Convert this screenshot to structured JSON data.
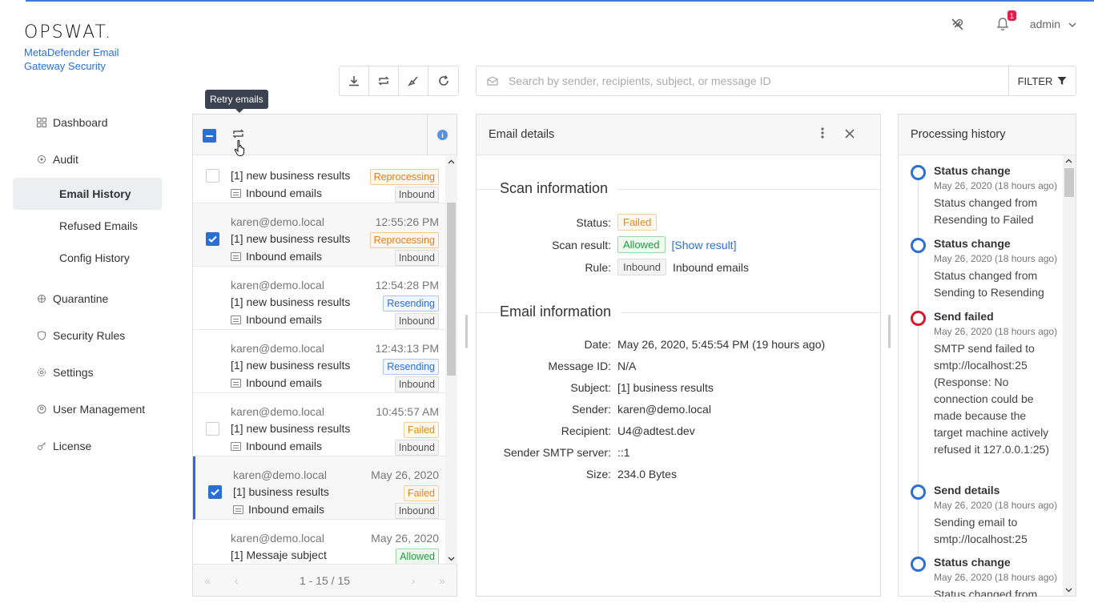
{
  "brand": {
    "logo": "OPSWAT.",
    "product": "MetaDefender Email Gateway Security"
  },
  "header": {
    "notification_count": "1",
    "user": "admin"
  },
  "nav": {
    "dashboard": "Dashboard",
    "audit": "Audit",
    "email_history": "Email History",
    "refused_emails": "Refused Emails",
    "config_history": "Config History",
    "quarantine": "Quarantine",
    "security_rules": "Security Rules",
    "settings": "Settings",
    "user_management": "User Management",
    "license": "License"
  },
  "search": {
    "placeholder": "Search by sender, recipients, subject, or message ID",
    "filter_label": "FILTER"
  },
  "tooltip": "Retry emails",
  "list": {
    "rows": [
      {
        "sender": "",
        "time": "",
        "subject": "[1] new business results",
        "status": "Reprocessing",
        "rule": "Inbound emails",
        "direction": "Inbound",
        "checked": false
      },
      {
        "sender": "karen@demo.local",
        "time": "12:55:26 PM",
        "subject": "[1] new business results",
        "status": "Reprocessing",
        "rule": "Inbound emails",
        "direction": "Inbound",
        "checked": true
      },
      {
        "sender": "karen@demo.local",
        "time": "12:54:28 PM",
        "subject": "[1] new business results",
        "status": "Resending",
        "rule": "Inbound emails",
        "direction": "Inbound",
        "checked": false
      },
      {
        "sender": "karen@demo.local",
        "time": "12:43:13 PM",
        "subject": "[1] new business results",
        "status": "Resending",
        "rule": "Inbound emails",
        "direction": "Inbound",
        "checked": false
      },
      {
        "sender": "karen@demo.local",
        "time": "10:45:57 AM",
        "subject": "[1] new business results",
        "status": "Failed",
        "rule": "Inbound emails",
        "direction": "Inbound",
        "checked": false
      },
      {
        "sender": "karen@demo.local",
        "time": "May 26, 2020",
        "subject": "[1] business results",
        "status": "Failed",
        "rule": "Inbound emails",
        "direction": "Inbound",
        "checked": true
      },
      {
        "sender": "karen@demo.local",
        "time": "May 26, 2020",
        "subject": "[1] Messaje subject",
        "status": "Allowed",
        "rule": "Inbound emails",
        "direction": "Inbound",
        "checked": false
      }
    ],
    "pagination": "1 - 15 / 15"
  },
  "details": {
    "title": "Email details",
    "scan_title": "Scan information",
    "status_label": "Status:",
    "status": "Failed",
    "scan_result_label": "Scan result:",
    "scan_result": "Allowed",
    "show_result": "[Show result]",
    "rule_label": "Rule:",
    "rule_tag": "Inbound",
    "rule_name": "Inbound emails",
    "email_title": "Email information",
    "fields": [
      {
        "label": "Date:",
        "value": "May 26, 2020, 5:45:54 PM (19 hours ago)"
      },
      {
        "label": "Message ID:",
        "value": "N/A"
      },
      {
        "label": "Subject:",
        "value": "[1] business results"
      },
      {
        "label": "Sender:",
        "value": "karen@demo.local"
      },
      {
        "label": "Recipient:",
        "value": "U4@adtest.dev"
      },
      {
        "label": "Sender SMTP server:",
        "value": "::1"
      },
      {
        "label": "Size:",
        "value": "234.0 Bytes"
      }
    ]
  },
  "history": {
    "title": "Processing history",
    "events": [
      {
        "title": "Status change",
        "date": "May 26, 2020 (18 hours ago)",
        "desc": "Status changed from Resending to Failed"
      },
      {
        "title": "Status change",
        "date": "May 26, 2020 (18 hours ago)",
        "desc": "Status changed from Sending to Resending"
      },
      {
        "title": "Send failed",
        "date": "May 26, 2020 (18 hours ago)",
        "desc": "SMTP send failed to smtp://localhost:25 (Response: No connection could be made because the target machine actively refused it 127.0.0.1:25)"
      },
      {
        "title": "Send details",
        "date": "May 26, 2020 (18 hours ago)",
        "desc": "Sending email to smtp://localhost:25"
      },
      {
        "title": "Status change",
        "date": "May 26, 2020 (18 hours ago)",
        "desc": "Status changed from"
      }
    ]
  },
  "colors": {
    "accent": "#2a6fd6",
    "failed": "#e48a13",
    "allowed": "#1e9c3c",
    "error": "#d9162e"
  }
}
